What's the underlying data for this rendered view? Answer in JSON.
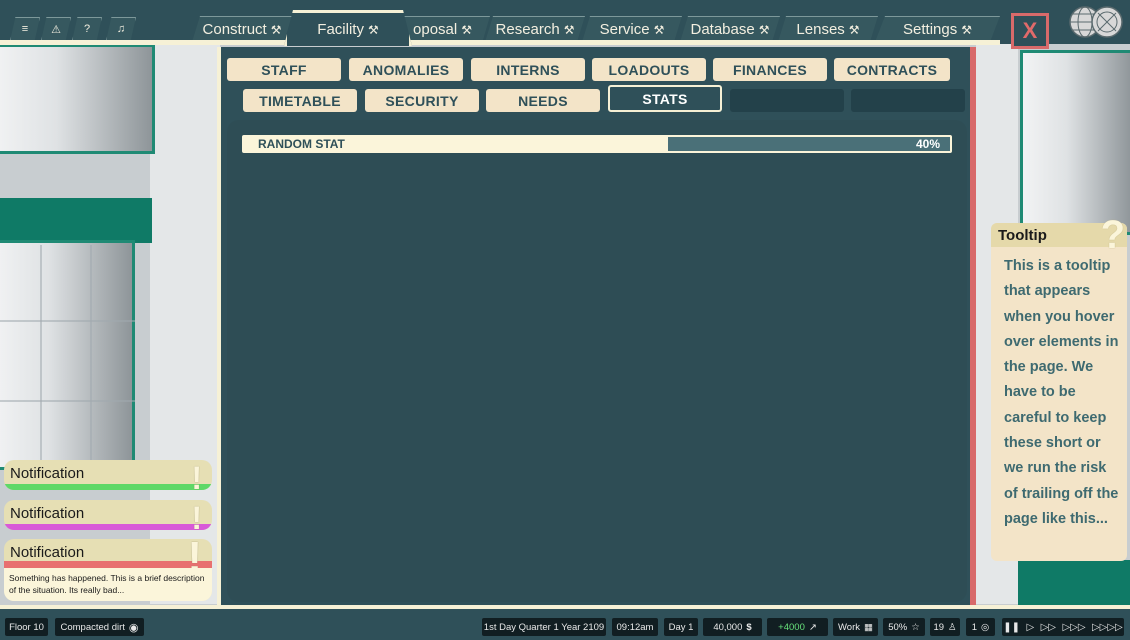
{
  "top_nav": {
    "system_icons": [
      "menu-icon",
      "warning-icon",
      "help-icon",
      "bell-icon"
    ],
    "tabs": [
      {
        "label": "Construct",
        "icon": "hammer-wrench-icon"
      },
      {
        "label": "Facility",
        "icon": "hammer-wrench-icon",
        "active": true
      },
      {
        "label": "oposal",
        "icon": "hammer-wrench-icon"
      },
      {
        "label": "Research",
        "icon": "hammer-wrench-icon"
      },
      {
        "label": "Service",
        "icon": "hammer-wrench-icon"
      },
      {
        "label": "Database",
        "icon": "hammer-wrench-icon"
      },
      {
        "label": "Lenses",
        "icon": "hammer-wrench-icon"
      },
      {
        "label": "Settings",
        "icon": "hammer-wrench-icon"
      }
    ],
    "close_label": "X"
  },
  "subtabs_row1": [
    "STAFF",
    "ANOMALIES",
    "INTERNS",
    "LOADOUTS",
    "FINANCES",
    "CONTRACTS"
  ],
  "subtabs_row2": [
    "TIMETABLE",
    "SECURITY",
    "NEEDS",
    "STATS",
    "",
    ""
  ],
  "active_subtab": "STATS",
  "stats": [
    {
      "label": "RANDOM STAT",
      "percent_label": "40%",
      "fraction": 0.4
    }
  ],
  "tooltip": {
    "title": "Tooltip",
    "body": "This is a tooltip that appears when you hover over elements in the page. We have to be careful to keep these short or we run the risk of trailing off the page like this..."
  },
  "notifications": [
    {
      "title": "Notification",
      "accent": "#5ed867",
      "mark": "!"
    },
    {
      "title": "Notification",
      "accent": "#d85ad8",
      "mark": "!"
    },
    {
      "title": "Notification",
      "accent": "#e87070",
      "mark": "!",
      "description": "Something has happened.  This is a brief description of the situation. Its really bad..."
    }
  ],
  "status_bar": {
    "floor": "Floor 10",
    "terrain": "Compacted dirt",
    "date": "1st Day Quarter 1 Year 2109",
    "time": "09:12am",
    "day": "Day 1",
    "money": "40,000",
    "money_symbol": "$",
    "income": "+4000",
    "mode": "Work",
    "percent": "50%",
    "staff_count": "19",
    "anomaly_count": "1",
    "speed_controls": [
      "pause",
      "play",
      "fast",
      "faster",
      "fastest"
    ]
  },
  "colors": {
    "panel": "#2f5059",
    "cream": "#f6f1d6",
    "pill": "#f3e4c8",
    "accent_red": "#d86a6a"
  }
}
